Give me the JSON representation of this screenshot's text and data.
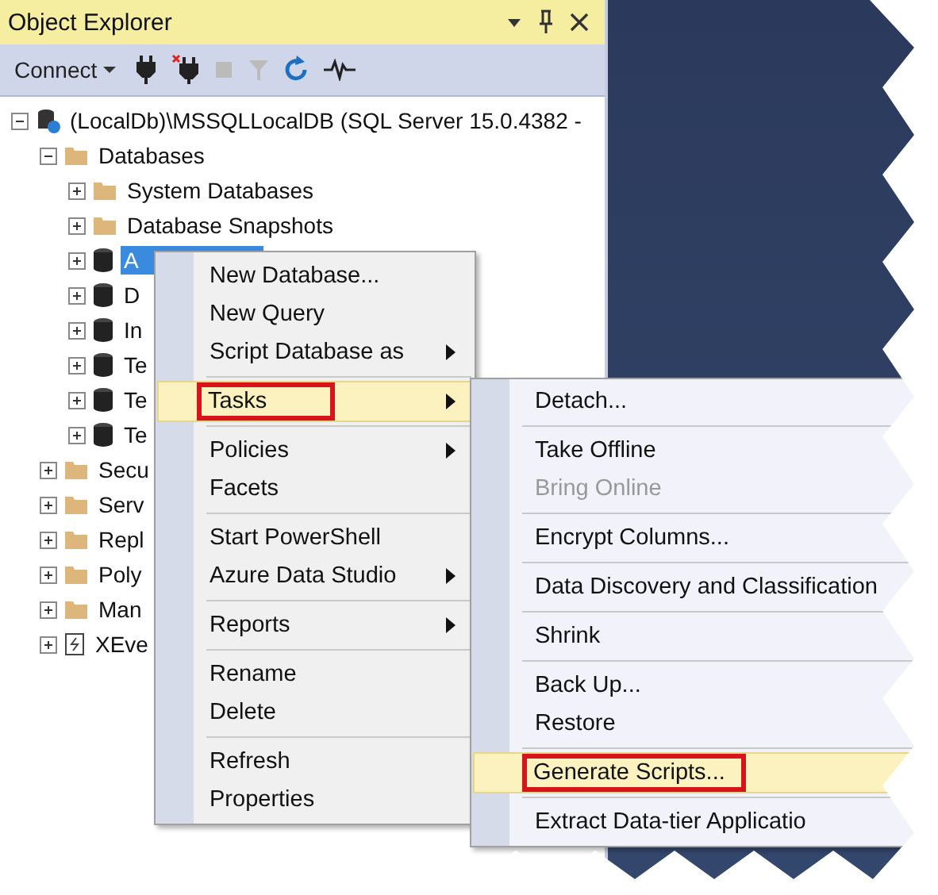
{
  "panel": {
    "title": "Object Explorer",
    "connect_label": "Connect"
  },
  "tree": [
    {
      "label": "(LocalDb)\\MSSQLLocalDB (SQL Server 15.0.4382 -",
      "kind": "server",
      "expanded": true,
      "selected": false,
      "children": [
        {
          "label": "Databases",
          "kind": "folder",
          "expanded": true,
          "selected": false,
          "children": [
            {
              "label": "System Databases",
              "kind": "folder",
              "expanded": false,
              "selected": false
            },
            {
              "label": "Database Snapshots",
              "kind": "folder",
              "expanded": false,
              "selected": false
            },
            {
              "label": "A",
              "kind": "database",
              "expanded": false,
              "selected": true
            },
            {
              "label": "D",
              "kind": "database",
              "expanded": false,
              "selected": false
            },
            {
              "label": "In",
              "kind": "database",
              "expanded": false,
              "selected": false
            },
            {
              "label": "Te",
              "kind": "database",
              "expanded": false,
              "selected": false
            },
            {
              "label": "Te",
              "kind": "database",
              "expanded": false,
              "selected": false
            },
            {
              "label": "Te",
              "kind": "database",
              "expanded": false,
              "selected": false
            }
          ]
        },
        {
          "label": "Secu",
          "kind": "folder",
          "expanded": false,
          "selected": false
        },
        {
          "label": "Serv",
          "kind": "folder",
          "expanded": false,
          "selected": false
        },
        {
          "label": "Repl",
          "kind": "folder",
          "expanded": false,
          "selected": false
        },
        {
          "label": "Poly",
          "kind": "folder",
          "expanded": false,
          "selected": false
        },
        {
          "label": "Man",
          "kind": "folder",
          "expanded": false,
          "selected": false
        },
        {
          "label": "XEve",
          "kind": "xevent",
          "expanded": false,
          "selected": false
        }
      ]
    }
  ],
  "context_menu": [
    {
      "kind": "item",
      "label": "New Database...",
      "submenu": false,
      "selected": false,
      "outlined": false
    },
    {
      "kind": "item",
      "label": "New Query",
      "submenu": false,
      "selected": false,
      "outlined": false
    },
    {
      "kind": "item",
      "label": "Script Database as",
      "submenu": true,
      "selected": false,
      "outlined": false
    },
    {
      "kind": "separator"
    },
    {
      "kind": "item",
      "label": "Tasks",
      "submenu": true,
      "selected": true,
      "outlined": true
    },
    {
      "kind": "separator"
    },
    {
      "kind": "item",
      "label": "Policies",
      "submenu": true,
      "selected": false,
      "outlined": false
    },
    {
      "kind": "item",
      "label": "Facets",
      "submenu": false,
      "selected": false,
      "outlined": false
    },
    {
      "kind": "separator"
    },
    {
      "kind": "item",
      "label": "Start PowerShell",
      "submenu": false,
      "selected": false,
      "outlined": false
    },
    {
      "kind": "item",
      "label": "Azure Data Studio",
      "submenu": true,
      "selected": false,
      "outlined": false
    },
    {
      "kind": "separator"
    },
    {
      "kind": "item",
      "label": "Reports",
      "submenu": true,
      "selected": false,
      "outlined": false
    },
    {
      "kind": "separator"
    },
    {
      "kind": "item",
      "label": "Rename",
      "submenu": false,
      "selected": false,
      "outlined": false
    },
    {
      "kind": "item",
      "label": "Delete",
      "submenu": false,
      "selected": false,
      "outlined": false
    },
    {
      "kind": "separator"
    },
    {
      "kind": "item",
      "label": "Refresh",
      "submenu": false,
      "selected": false,
      "outlined": false
    },
    {
      "kind": "item",
      "label": "Properties",
      "submenu": false,
      "selected": false,
      "outlined": false
    }
  ],
  "tasks_submenu": [
    {
      "kind": "item",
      "label": "Detach...",
      "disabled": false,
      "selected": false,
      "outlined": false
    },
    {
      "kind": "separator"
    },
    {
      "kind": "item",
      "label": "Take Offline",
      "disabled": false,
      "selected": false,
      "outlined": false
    },
    {
      "kind": "item",
      "label": "Bring Online",
      "disabled": true,
      "selected": false,
      "outlined": false
    },
    {
      "kind": "separator"
    },
    {
      "kind": "item",
      "label": "Encrypt Columns...",
      "disabled": false,
      "selected": false,
      "outlined": false
    },
    {
      "kind": "separator"
    },
    {
      "kind": "item",
      "label": "Data Discovery and Classification",
      "disabled": false,
      "selected": false,
      "outlined": false
    },
    {
      "kind": "separator"
    },
    {
      "kind": "item",
      "label": "Shrink",
      "disabled": false,
      "selected": false,
      "outlined": false
    },
    {
      "kind": "separator"
    },
    {
      "kind": "item",
      "label": "Back Up...",
      "disabled": false,
      "selected": false,
      "outlined": false
    },
    {
      "kind": "item",
      "label": "Restore",
      "disabled": false,
      "selected": false,
      "outlined": false
    },
    {
      "kind": "separator"
    },
    {
      "kind": "item",
      "label": "Generate Scripts...",
      "disabled": false,
      "selected": true,
      "outlined": true
    },
    {
      "kind": "separator"
    },
    {
      "kind": "item",
      "label": "Extract Data-tier Applicatio",
      "disabled": false,
      "selected": false,
      "outlined": false
    }
  ]
}
